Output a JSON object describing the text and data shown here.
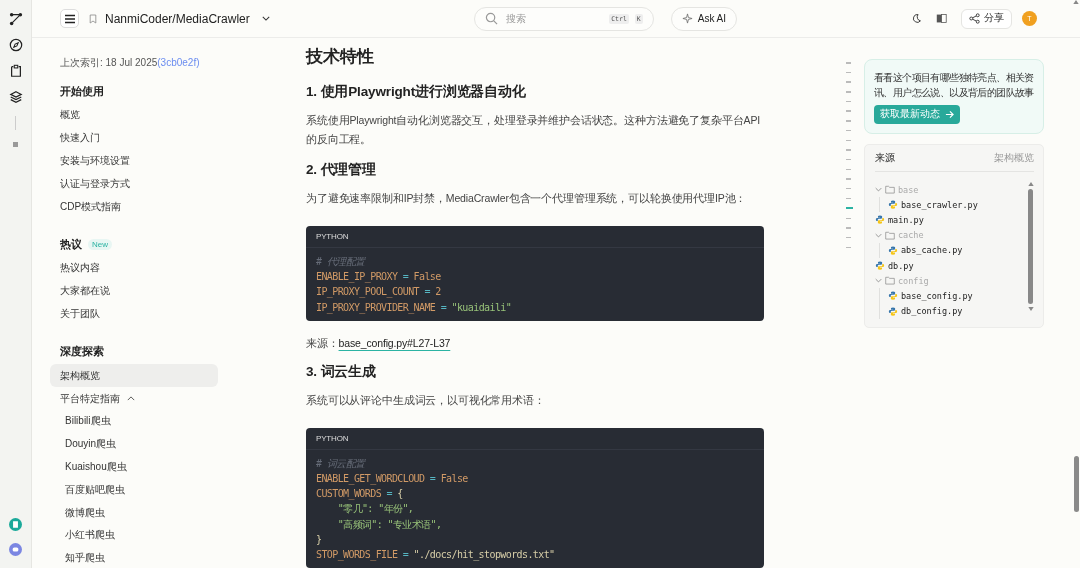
{
  "header": {
    "repo": "NanmiCoder/MediaCrawler",
    "search": {
      "placeholder": "搜索",
      "keys": [
        "Ctrl",
        "K"
      ]
    },
    "ask_ai": "Ask AI",
    "share": "分享",
    "avatar": "T"
  },
  "sidebar": {
    "index_label": "上次索引: 18 Jul 2025",
    "commit": "(3cb0e2f)",
    "sections": [
      {
        "title": "开始使用",
        "items": [
          {
            "label": "概览",
            "selected": false
          },
          {
            "label": "快速入门",
            "selected": false
          },
          {
            "label": "安装与环境设置",
            "selected": false
          },
          {
            "label": "认证与登录方式",
            "selected": false
          },
          {
            "label": "CDP模式指南",
            "selected": false
          }
        ]
      },
      {
        "title": "热议",
        "badge": "New",
        "items": [
          {
            "label": "热议内容",
            "selected": false
          },
          {
            "label": "大家都在说",
            "selected": false
          },
          {
            "label": "关于团队",
            "selected": false
          }
        ]
      },
      {
        "title": "深度探索",
        "items": [
          {
            "label": "架构概览",
            "selected": true
          },
          {
            "label": "平台特定指南",
            "selected": false,
            "expanded": true,
            "children": [
              {
                "label": "Bilibili爬虫",
                "selected": false
              },
              {
                "label": "Douyin爬虫",
                "selected": false
              },
              {
                "label": "Kuaishou爬虫",
                "selected": false
              },
              {
                "label": "百度贴吧爬虫",
                "selected": false
              },
              {
                "label": "微博爬虫",
                "selected": false
              },
              {
                "label": "小红书爬虫",
                "selected": false
              },
              {
                "label": "知乎爬虫",
                "selected": false
              }
            ]
          }
        ]
      }
    ]
  },
  "content": [
    {
      "kind": "h2",
      "text": "技术特性"
    },
    {
      "kind": "h3",
      "text": "1. 使用Playwright进行浏览器自动化"
    },
    {
      "kind": "p",
      "text": "系统使用Playwright自动化浏览器交互，处理登录并维护会话状态。这种方法避免了复杂平台API的反向工程。"
    },
    {
      "kind": "h3",
      "text": "2. 代理管理"
    },
    {
      "kind": "p",
      "text": "为了避免速率限制和IP封禁，MediaCrawler包含一个代理管理系统，可以轮换使用代理IP池："
    },
    {
      "kind": "code",
      "lang": "PYTHON",
      "lines": [
        [
          {
            "t": "# 代理配置",
            "kind": "comment"
          }
        ],
        [
          {
            "t": "ENABLE_IP_PROXY",
            "kind": "var"
          },
          {
            "t": " = ",
            "kind": "op"
          },
          {
            "t": "False",
            "kind": "var"
          }
        ],
        [
          {
            "t": "IP_PROXY_POOL_COUNT",
            "kind": "var"
          },
          {
            "t": " = ",
            "kind": "op"
          },
          {
            "t": "2",
            "kind": "var"
          }
        ],
        [
          {
            "t": "IP_PROXY_PROVIDER_NAME",
            "kind": "var"
          },
          {
            "t": " = ",
            "kind": "op"
          },
          {
            "t": "\"kuaidaili\"",
            "kind": "str"
          }
        ]
      ]
    },
    {
      "kind": "source",
      "label": "来源：",
      "link": "base_config.py#L27-L37"
    },
    {
      "kind": "h3",
      "text": "3. 词云生成"
    },
    {
      "kind": "p",
      "text": "系统可以从评论中生成词云，以可视化常用术语："
    },
    {
      "kind": "code",
      "lang": "PYTHON",
      "lines": [
        [
          {
            "t": "# 词云配置",
            "kind": "comment"
          }
        ],
        [
          {
            "t": "ENABLE_GET_WORDCLOUD",
            "kind": "var"
          },
          {
            "t": " = ",
            "kind": "op"
          },
          {
            "t": "False",
            "kind": "var"
          }
        ],
        [
          {
            "t": "CUSTOM_WORDS",
            "kind": "var"
          },
          {
            "t": " = ",
            "kind": "op"
          },
          {
            "t": "{",
            "kind": "plain"
          }
        ],
        [
          {
            "t": "    \"零几\": \"年份\",",
            "kind": "str"
          }
        ],
        [
          {
            "t": "    \"高频词\": \"专业术语\",",
            "kind": "str"
          }
        ],
        [
          {
            "t": "}",
            "kind": "plain"
          }
        ],
        [
          {
            "t": "STOP_WORDS_FILE",
            "kind": "var"
          },
          {
            "t": " = ",
            "kind": "op"
          },
          {
            "t": "\"./docs/hit_stopwords.txt\"",
            "kind": "plain"
          }
        ]
      ]
    }
  ],
  "toc_marks": [
    {
      "selected": false
    },
    {
      "selected": false
    },
    {
      "selected": false
    },
    {
      "selected": false
    },
    {
      "selected": false
    },
    {
      "selected": false
    },
    {
      "selected": false
    },
    {
      "selected": false
    },
    {
      "selected": false
    },
    {
      "selected": false
    },
    {
      "selected": false
    },
    {
      "selected": false
    },
    {
      "selected": false
    },
    {
      "selected": false
    },
    {
      "selected": false
    },
    {
      "selected": true
    },
    {
      "selected": false
    },
    {
      "selected": false
    },
    {
      "selected": false
    },
    {
      "selected": false
    }
  ],
  "promo": {
    "text": "看看这个项目有哪些独特亮点、相关资讯、用户怎么说、以及背后的团队故事",
    "button": "获取最新动态"
  },
  "sources": {
    "title": "来源",
    "link": "架构概览",
    "tree": [
      {
        "name": "base",
        "kind": "folder",
        "expanded": true,
        "children": [
          {
            "name": "base_crawler.py",
            "kind": "file"
          }
        ]
      },
      {
        "name": "main.py",
        "kind": "file"
      },
      {
        "name": "cache",
        "kind": "folder",
        "expanded": true,
        "children": [
          {
            "name": "abs_cache.py",
            "kind": "file"
          }
        ]
      },
      {
        "name": "db.py",
        "kind": "file"
      },
      {
        "name": "config",
        "kind": "folder",
        "expanded": true,
        "children": [
          {
            "name": "base_config.py",
            "kind": "file"
          },
          {
            "name": "db_config.py",
            "kind": "file"
          }
        ]
      }
    ]
  }
}
